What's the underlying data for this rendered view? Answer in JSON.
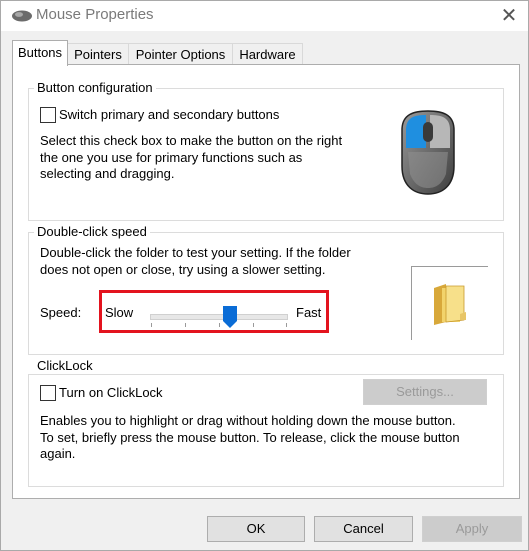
{
  "window": {
    "title": "Mouse Properties",
    "close_glyph": "✕"
  },
  "tabs": [
    {
      "label": "Buttons"
    },
    {
      "label": "Pointers"
    },
    {
      "label": "Pointer Options"
    },
    {
      "label": "Hardware"
    }
  ],
  "button_config": {
    "heading": "Button configuration",
    "checkbox_label": "Switch primary and secondary buttons",
    "checked": false,
    "desc_line1": "Select this check box to make the button on the right",
    "desc_line2": "the one you use for primary functions such as",
    "desc_line3": "selecting and dragging."
  },
  "double_click": {
    "heading": "Double-click speed",
    "desc_line1": "Double-click the folder to test your setting. If the folder",
    "desc_line2": "does not open or close, try using a slower setting.",
    "speed_label": "Speed:",
    "slow_label": "Slow",
    "fast_label": "Fast",
    "slider_value": 0.55
  },
  "clicklock": {
    "heading": "ClickLock",
    "checkbox_label": "Turn on ClickLock",
    "checked": false,
    "settings_label": "Settings...",
    "desc_line1": "Enables you to highlight or drag without holding down the mouse button.",
    "desc_line2": "To set, briefly press the mouse button. To release, click the mouse button",
    "desc_line3": "again."
  },
  "footer": {
    "ok": "OK",
    "cancel": "Cancel",
    "apply": "Apply"
  },
  "colors": {
    "highlight": "#e3131e",
    "slider_thumb": "#0a6cd6",
    "mouse_primary": "#1f8fe0"
  }
}
